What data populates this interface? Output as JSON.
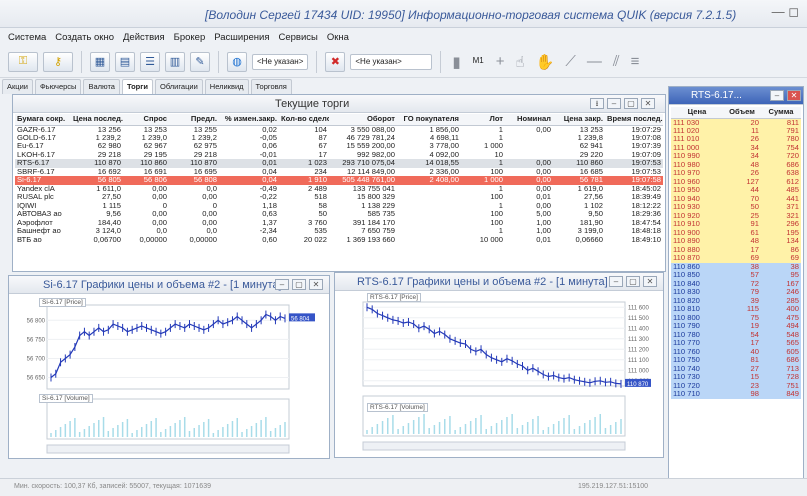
{
  "window": {
    "title": "[Володин Сергей 17434 UID: 19950] Информационно-торговая система QUIK (версия 7.2.1.5)",
    "controls": "— ◻"
  },
  "menu": [
    "Система",
    "Создать окно",
    "Действия",
    "Брокер",
    "Расширения",
    "Сервисы",
    "Окна"
  ],
  "toolbar": {
    "account1": "<Не указан>",
    "account2": "<Не указан>",
    "interval": "M1"
  },
  "tabs": [
    {
      "label": "Акции",
      "active": false
    },
    {
      "label": "Фьючерсы",
      "active": false
    },
    {
      "label": "Валюта",
      "active": false
    },
    {
      "label": "Торги",
      "active": true
    },
    {
      "label": "Облигации",
      "active": false
    },
    {
      "label": "Неликвид",
      "active": false
    },
    {
      "label": "Торговля",
      "active": false
    }
  ],
  "trades": {
    "title": "Текущие торги",
    "columns": [
      "Бумага сокр.",
      "Цена послед.",
      "Спрос",
      "Предл.",
      "% измен.закр.",
      "Кол-во сделок",
      "Оборот",
      "ГО покупателя",
      "Лот",
      "Номинал",
      "Цена закр.",
      "Время послед."
    ],
    "rows": [
      {
        "c": [
          "GAZR-6.17",
          "13 256",
          "13 253",
          "13 255",
          "0,02",
          "104",
          "3 550 088,00",
          "1 856,00",
          "1",
          "0,00",
          "13 253",
          "19:07:29"
        ],
        "s": ""
      },
      {
        "c": [
          "GOLD-6.17",
          "1 239,2",
          "1 239,0",
          "1 239,2",
          "-0,05",
          "87",
          "46 729 781,24",
          "4 698,11",
          "1",
          "",
          "1 239,8",
          "19:07:08"
        ],
        "s": ""
      },
      {
        "c": [
          "Eu-6.17",
          "62 980",
          "62 967",
          "62 975",
          "0,06",
          "67",
          "15 559 200,00",
          "3 778,00",
          "1 000",
          "",
          "62 941",
          "19:07:39"
        ],
        "s": ""
      },
      {
        "c": [
          "LKOH-6.17",
          "29 218",
          "29 195",
          "29 218",
          "-0,01",
          "17",
          "992 982,00",
          "4 092,00",
          "10",
          "",
          "29 220",
          "19:07:09"
        ],
        "s": ""
      },
      {
        "c": [
          "RTS-6.17",
          "110 870",
          "110 860",
          "110 870",
          "0,01",
          "1 023",
          "293 710 075,04",
          "14 018,55",
          "1",
          "0,00",
          "110 860",
          "19:07:53"
        ],
        "s": "grey"
      },
      {
        "c": [
          "SBRF-6.17",
          "16 692",
          "16 691",
          "16 695",
          "0,04",
          "234",
          "12 114 849,00",
          "2 336,00",
          "100",
          "0,00",
          "16 685",
          "19:07:53"
        ],
        "s": ""
      },
      {
        "c": [
          "Si-6.17",
          "56 805",
          "56 806",
          "56 808",
          "0,04",
          "1 910",
          "505 448 761,00",
          "2 408,00",
          "1 000",
          "0,00",
          "56 781",
          "19:07:58"
        ],
        "s": "sel"
      },
      {
        "c": [
          "Yandex clA",
          "1 611,0",
          "0,00",
          "0,0",
          "-0,49",
          "2 489",
          "133 755 041",
          "",
          "1",
          "0,00",
          "1 619,0",
          "18:45:02"
        ],
        "s": ""
      },
      {
        "c": [
          "RUSAL plc",
          "27,50",
          "0,00",
          "0,00",
          "-0,22",
          "518",
          "15 800 329",
          "",
          "100",
          "0,01",
          "27,56",
          "18:39:49"
        ],
        "s": ""
      },
      {
        "c": [
          "IQIWI",
          "1 115",
          "0",
          "0",
          "1,18",
          "58",
          "1 138 229",
          "",
          "1",
          "0,00",
          "1 102",
          "18:12:22"
        ],
        "s": ""
      },
      {
        "c": [
          "АВТОВАЗ ао",
          "9,56",
          "0,00",
          "0,00",
          "0,63",
          "50",
          "585 735",
          "",
          "100",
          "5,00",
          "9,50",
          "18:29:36"
        ],
        "s": ""
      },
      {
        "c": [
          "Аэрофлот",
          "184,40",
          "0,00",
          "0,00",
          "1,37",
          "3 760",
          "391 184 170",
          "",
          "100",
          "1,00",
          "181,90",
          "18:47:54"
        ],
        "s": ""
      },
      {
        "c": [
          "Башнефт ао",
          "3 124,0",
          "0,0",
          "0,0",
          "-2,34",
          "535",
          "7 650 759",
          "",
          "1",
          "1,00",
          "3 199,0",
          "18:48:18"
        ],
        "s": ""
      },
      {
        "c": [
          "ВТБ ао",
          "0,06700",
          "0,00000",
          "0,00000",
          "0,60",
          "20 022",
          "1 369 193 660",
          "",
          "10 000",
          "0,01",
          "0,06660",
          "18:49:10"
        ],
        "s": ""
      }
    ]
  },
  "chart_data": [
    {
      "type": "line",
      "title": "Si-6.17 Графики цены и объема #2 - [1 минута]",
      "price_legend": "Si-6.17 [Price]",
      "volume_legend": "Si-6.17 [Volume]",
      "y_ticks": [
        "56 800",
        "56 750",
        "56 700",
        "56 650"
      ],
      "ylim": [
        56620,
        56840
      ],
      "last_price": "56 804",
      "values": [
        56650,
        56660,
        56690,
        56700,
        56710,
        56730,
        56760,
        56770,
        56760,
        56770,
        56780,
        56770,
        56775,
        56790,
        56785,
        56780,
        56770,
        56775,
        56780,
        56785,
        56780,
        56775,
        56770,
        56765,
        56770,
        56780,
        56790,
        56785,
        56780,
        56790,
        56785,
        56780,
        56775,
        56780,
        56790,
        56800,
        56790,
        56795,
        56800,
        56810,
        56800,
        56790,
        56780,
        56790,
        56800,
        56815,
        56810,
        56800,
        56810,
        56805
      ]
    },
    {
      "type": "line",
      "title": "RTS-6.17 Графики цены и объема #2 - [1 минута]",
      "price_legend": "RTS-6.17 [Price]",
      "volume_legend": "RTS-6.17 [Volume]",
      "y_ticks": [
        "111 600",
        "111 500",
        "111 400",
        "111 300",
        "111 200",
        "111 100",
        "111 000",
        "110 900"
      ],
      "ylim": [
        110850,
        111650
      ],
      "last_price": "110 870",
      "values": [
        111600,
        111580,
        111540,
        111520,
        111500,
        111480,
        111470,
        111450,
        111460,
        111440,
        111400,
        111420,
        111390,
        111350,
        111370,
        111340,
        111300,
        111280,
        111260,
        111250,
        111200,
        111180,
        111200,
        111150,
        111120,
        111100,
        111080,
        111110,
        111090,
        111060,
        111040,
        111000,
        111020,
        110990,
        110960,
        110940,
        110950,
        110930,
        110920,
        110930,
        110910,
        110900,
        110890,
        110880,
        110895,
        110900,
        110885,
        110890,
        110875,
        110870
      ]
    }
  ],
  "orderbook": {
    "title": "RTS-6.17...",
    "columns": [
      "Цена",
      "Объем",
      "Сумма"
    ],
    "asks": [
      [
        "111 030",
        "20",
        "811"
      ],
      [
        "111 020",
        "11",
        "791"
      ],
      [
        "111 010",
        "26",
        "780"
      ],
      [
        "111 000",
        "34",
        "754"
      ],
      [
        "110 990",
        "34",
        "720"
      ],
      [
        "110 980",
        "48",
        "686"
      ],
      [
        "110 970",
        "26",
        "638"
      ],
      [
        "110 960",
        "127",
        "612"
      ],
      [
        "110 950",
        "44",
        "485"
      ],
      [
        "110 940",
        "70",
        "441"
      ],
      [
        "110 930",
        "50",
        "371"
      ],
      [
        "110 920",
        "25",
        "321"
      ],
      [
        "110 910",
        "91",
        "296"
      ],
      [
        "110 900",
        "61",
        "195"
      ],
      [
        "110 890",
        "48",
        "134"
      ],
      [
        "110 880",
        "17",
        "86"
      ],
      [
        "110 870",
        "69",
        "69"
      ]
    ],
    "bids": [
      [
        "110 860",
        "38",
        "38"
      ],
      [
        "110 850",
        "57",
        "95"
      ],
      [
        "110 840",
        "72",
        "167"
      ],
      [
        "110 830",
        "79",
        "246"
      ],
      [
        "110 820",
        "39",
        "285"
      ],
      [
        "110 810",
        "115",
        "400"
      ],
      [
        "110 800",
        "75",
        "475"
      ],
      [
        "110 790",
        "19",
        "494"
      ],
      [
        "110 780",
        "54",
        "548"
      ],
      [
        "110 770",
        "17",
        "565"
      ],
      [
        "110 760",
        "40",
        "605"
      ],
      [
        "110 750",
        "81",
        "686"
      ],
      [
        "110 740",
        "27",
        "713"
      ],
      [
        "110 730",
        "15",
        "728"
      ],
      [
        "110 720",
        "23",
        "751"
      ],
      [
        "110 710",
        "98",
        "849"
      ]
    ]
  },
  "status": {
    "left": "Мин. скорость: 100,37 Кб, записей: 55007, текущая: 1071639",
    "right": "195.219.127.51:15100"
  }
}
